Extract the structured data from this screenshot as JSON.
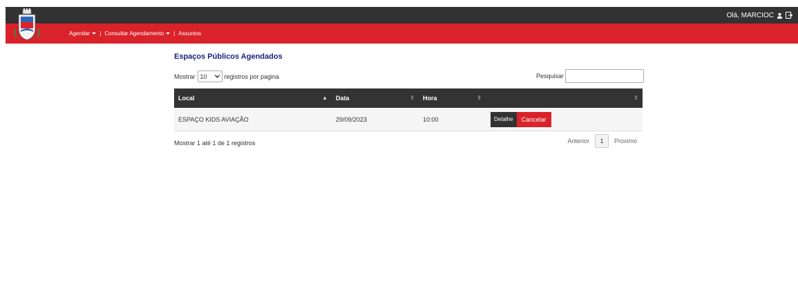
{
  "header": {
    "greeting": "Olá, MARCIOC",
    "user_icon": "user-icon",
    "logout_icon": "logout-icon"
  },
  "nav": {
    "items": [
      {
        "label": "Agendar",
        "dropdown": true
      },
      {
        "label": "Consultar Agendamento",
        "dropdown": true
      },
      {
        "label": "Assuntos",
        "dropdown": false
      }
    ]
  },
  "page": {
    "title": "Espaços Públicos Agendados",
    "length": {
      "prefix": "Mostrar",
      "value": "10",
      "suffix": "registros por pagina"
    },
    "search": {
      "label": "Pesquisar",
      "value": ""
    },
    "table": {
      "columns": [
        "Local",
        "Data",
        "Hora",
        ""
      ],
      "rows": [
        {
          "local": "ESPAÇO KIDS AVIAÇÃO",
          "data": "29/09/2023",
          "hora": "10:00",
          "detail_label": "Detalhe",
          "cancel_label": "Cancelar"
        }
      ]
    },
    "info": "Mostrar 1 até 1 de 1 registros",
    "pagination": {
      "previous": "Anterior",
      "current": "1",
      "next": "Proximo"
    }
  },
  "colors": {
    "topbar": "#323232",
    "navbar": "#d9222a",
    "title": "#1a237e",
    "table_header": "#333333",
    "cancel_button": "#d9222a"
  }
}
